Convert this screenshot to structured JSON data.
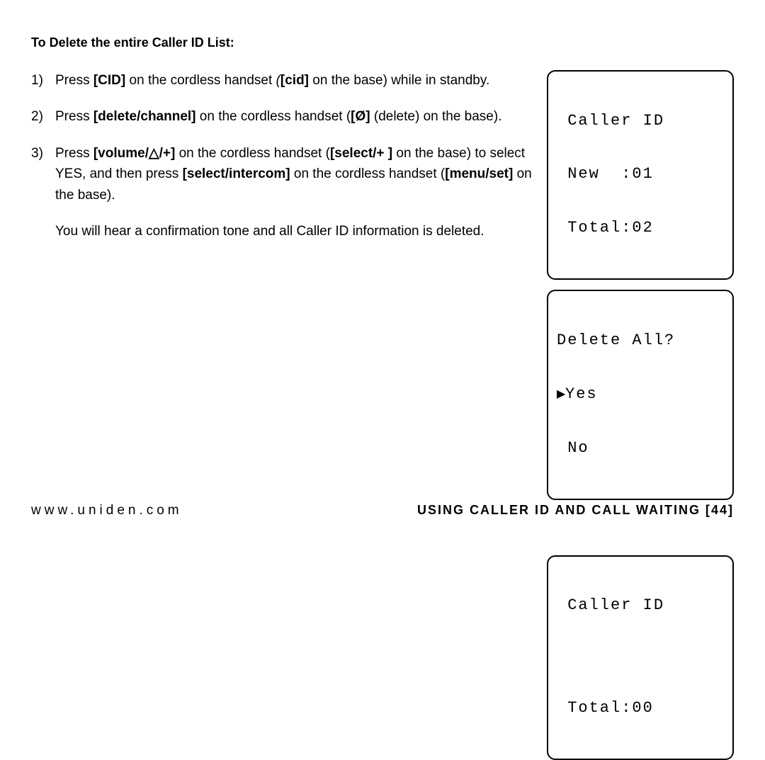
{
  "heading": "To Delete the entire Caller ID List:",
  "steps": {
    "1": {
      "num": "1)",
      "t1": "Press ",
      "b1": "[CID]",
      "t2": " on the cordless handset ",
      "i1": "(",
      "b2": "[cid]",
      "t3": " on the base) while in standby."
    },
    "2": {
      "num": "2)",
      "t1": "Press ",
      "b1": "[delete/channel]",
      "t2": " on the cordless handset (",
      "b2o": "[",
      "icon": "Ø",
      "b2c": "]",
      "t3": " (delete) on the base)."
    },
    "3": {
      "num": "3)",
      "t1": "Press ",
      "b1o": "[volume/",
      "icon": "△",
      "b1c": "/+]",
      "t2": " on the cordless handset (",
      "b2": "[select/+ ]",
      "t3": " on the base) to select YES, and then press ",
      "b3": "[select/intercom]",
      "t4": " on the cordless handset (",
      "b4": "[menu/set]",
      "t5": " on the base).",
      "follow": "You will hear a confirmation tone and all Caller ID information is deleted."
    }
  },
  "lcd": {
    "1": {
      "l1": " Caller ID",
      "l2": " New  :01",
      "l3": " Total:02"
    },
    "2": {
      "l1": "Delete All?",
      "yes": "Yes",
      "no": " No"
    },
    "3": {
      "l1": " Caller ID",
      "l2": " Total:00"
    }
  },
  "footer": {
    "left": "www.uniden.com",
    "right": "USING CALLER ID AND CALL WAITING [44]"
  }
}
